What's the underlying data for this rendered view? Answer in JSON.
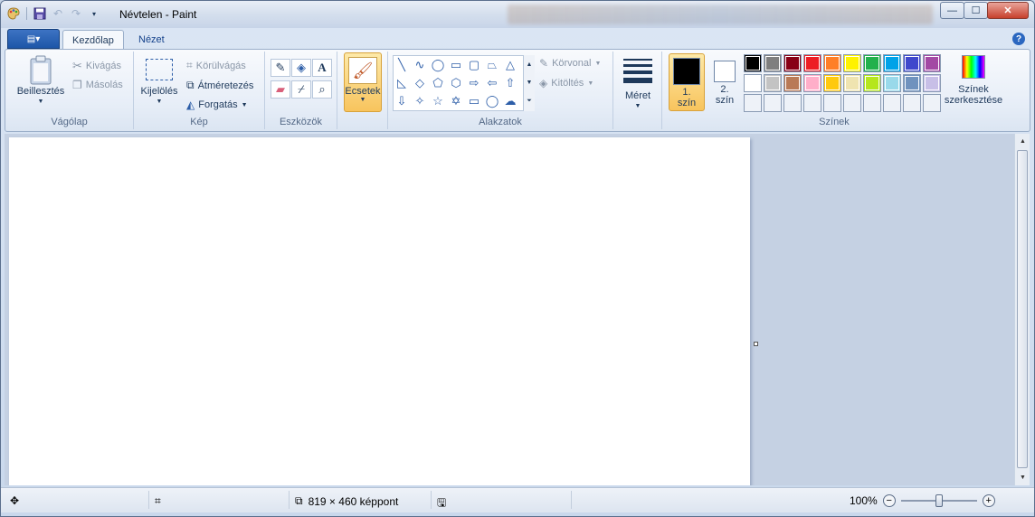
{
  "app": {
    "title": "Névtelen - Paint"
  },
  "window_controls": {
    "minimize": "—",
    "maximize": "☐",
    "close": "✕"
  },
  "tabs": {
    "file_icon": "▤▾",
    "home": "Kezdőlap",
    "view": "Nézet",
    "help": "?"
  },
  "clipboard": {
    "paste": "Beillesztés",
    "cut": "Kivágás",
    "copy": "Másolás",
    "label": "Vágólap"
  },
  "image": {
    "select": "Kijelölés",
    "crop": "Körülvágás",
    "resize": "Átméretezés",
    "rotate": "Forgatás",
    "label": "Kép"
  },
  "tools": {
    "label": "Eszközök",
    "text_glyph": "A"
  },
  "brushes": {
    "label": "Ecsetek"
  },
  "shapes": {
    "outline": "Körvonal",
    "fill": "Kitöltés",
    "label": "Alakzatok"
  },
  "size": {
    "label": "Méret"
  },
  "colors": {
    "color1_line1": "1.",
    "color1_line2": "szín",
    "color2_line1": "2.",
    "color2_line2": "szín",
    "edit_line1": "Színek",
    "edit_line2": "szerkesztése",
    "label": "Színek",
    "color1_value": "#000000",
    "color2_value": "#ffffff",
    "palette": [
      "#000000",
      "#7f7f7f",
      "#880015",
      "#ed1c24",
      "#ff7f27",
      "#fff200",
      "#22b14c",
      "#00a2e8",
      "#3f48cc",
      "#a349a4",
      "#ffffff",
      "#c3c3c3",
      "#b97a57",
      "#ffaec9",
      "#ffc90e",
      "#efe4b0",
      "#b5e61d",
      "#99d9ea",
      "#7092be",
      "#c8bfe7",
      "",
      "",
      "",
      "",
      "",
      "",
      "",
      "",
      "",
      ""
    ]
  },
  "status": {
    "size": "819 × 460 képpont",
    "zoom": "100%",
    "zoom_level": 1.0
  }
}
